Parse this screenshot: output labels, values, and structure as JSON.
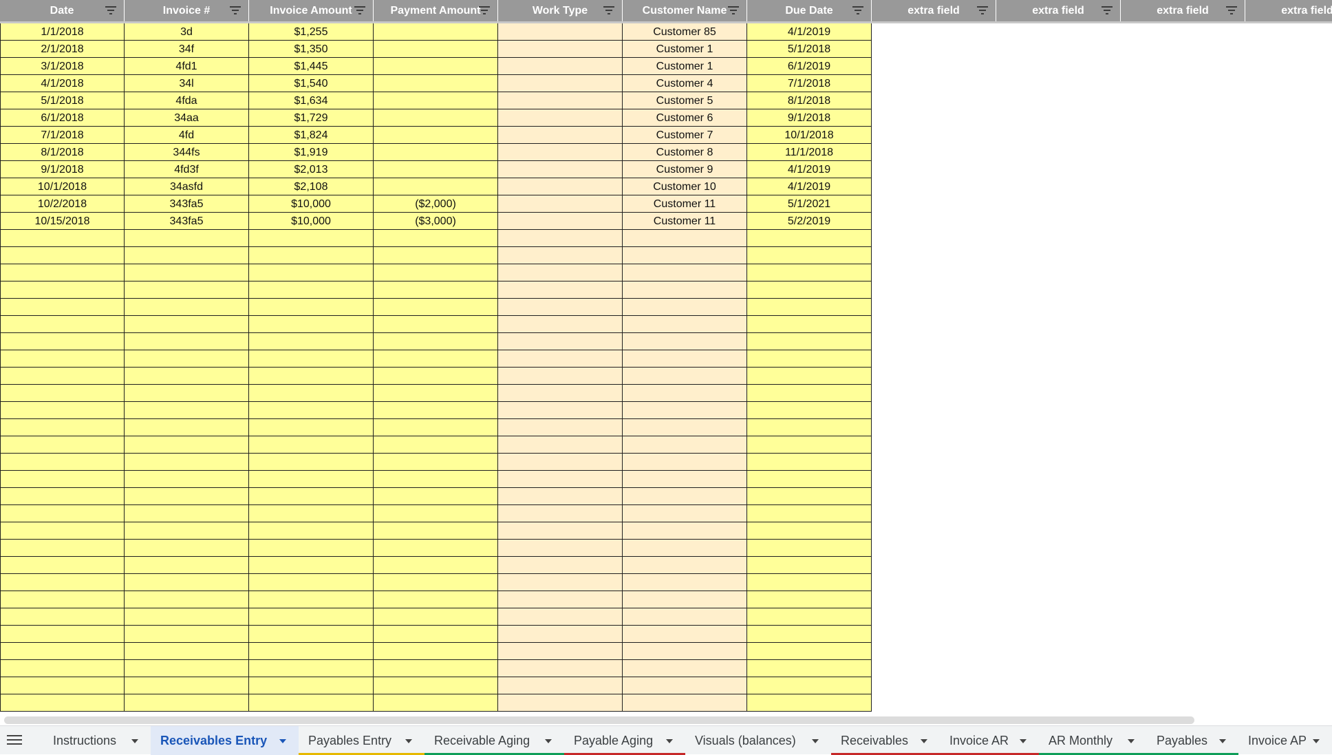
{
  "columns": [
    {
      "label": "Date",
      "filter_icon": "filter-icon"
    },
    {
      "label": "Invoice #",
      "filter_icon": "filter-icon"
    },
    {
      "label": "Invoice Amount",
      "filter_icon": "filter-icon"
    },
    {
      "label": "Payment Amount",
      "filter_icon": "filter-icon"
    },
    {
      "label": "Work Type",
      "filter_icon": "filter-icon"
    },
    {
      "label": "Customer Name",
      "filter_icon": "filter-icon"
    },
    {
      "label": "Due Date",
      "filter_icon": "filter-icon"
    },
    {
      "label": "extra field",
      "filter_icon": "filter-icon"
    },
    {
      "label": "extra field",
      "filter_icon": "filter-icon"
    },
    {
      "label": "extra field",
      "filter_icon": "filter-icon"
    },
    {
      "label": "extra field",
      "filter_icon": "filter-icon"
    }
  ],
  "rows": [
    [
      "1/1/2018",
      "3d",
      "$1,255",
      "",
      "",
      "Customer 85",
      "4/1/2019"
    ],
    [
      "2/1/2018",
      "34f",
      "$1,350",
      "",
      "",
      "Customer 1",
      "5/1/2018"
    ],
    [
      "3/1/2018",
      "4fd1",
      "$1,445",
      "",
      "",
      "Customer 1",
      "6/1/2019"
    ],
    [
      "4/1/2018",
      "34l",
      "$1,540",
      "",
      "",
      "Customer 4",
      "7/1/2018"
    ],
    [
      "5/1/2018",
      "4fda",
      "$1,634",
      "",
      "",
      "Customer 5",
      "8/1/2018"
    ],
    [
      "6/1/2018",
      "34aa",
      "$1,729",
      "",
      "",
      "Customer 6",
      "9/1/2018"
    ],
    [
      "7/1/2018",
      "4fd",
      "$1,824",
      "",
      "",
      "Customer 7",
      "10/1/2018"
    ],
    [
      "8/1/2018",
      "344fs",
      "$1,919",
      "",
      "",
      "Customer 8",
      "11/1/2018"
    ],
    [
      "9/1/2018",
      "4fd3f",
      "$2,013",
      "",
      "",
      "Customer 9",
      "4/1/2019"
    ],
    [
      "10/1/2018",
      "34asfd",
      "$2,108",
      "",
      "",
      "Customer 10",
      "4/1/2019"
    ],
    [
      "10/2/2018",
      "343fa5",
      "$10,000",
      "($2,000)",
      "",
      "Customer 11",
      "5/1/2021"
    ],
    [
      "10/15/2018",
      "343fa5",
      "$10,000",
      "($3,000)",
      "",
      "Customer 11",
      "5/2/2019"
    ]
  ],
  "colors": {
    "header_bg": "#999999",
    "cell_yellow": "#ffff99",
    "cell_peach": "#ffefcc",
    "active_tab_text": "#1a56b8"
  },
  "sheet_tabs": {
    "menu_icon": "menu-icon",
    "tabs": [
      {
        "label": "Instructions",
        "active": false,
        "color": ""
      },
      {
        "label": "Receivables Entry",
        "active": true,
        "color": ""
      },
      {
        "label": "Payables Entry",
        "active": false,
        "color": "#e6b800"
      },
      {
        "label": "Receivable Aging",
        "active": false,
        "color": "#0f9d58"
      },
      {
        "label": "Payable Aging",
        "active": false,
        "color": "#c62828"
      },
      {
        "label": "Visuals (balances)",
        "active": false,
        "color": ""
      },
      {
        "label": "Receivables",
        "active": false,
        "color": "#c62828"
      },
      {
        "label": "Invoice AR",
        "active": false,
        "color": "#c62828"
      },
      {
        "label": "AR Monthly",
        "active": false,
        "color": "#0f9d58"
      },
      {
        "label": "Payables",
        "active": false,
        "color": "#0f9d58"
      },
      {
        "label": "Invoice AP",
        "active": false,
        "color": ""
      }
    ]
  }
}
